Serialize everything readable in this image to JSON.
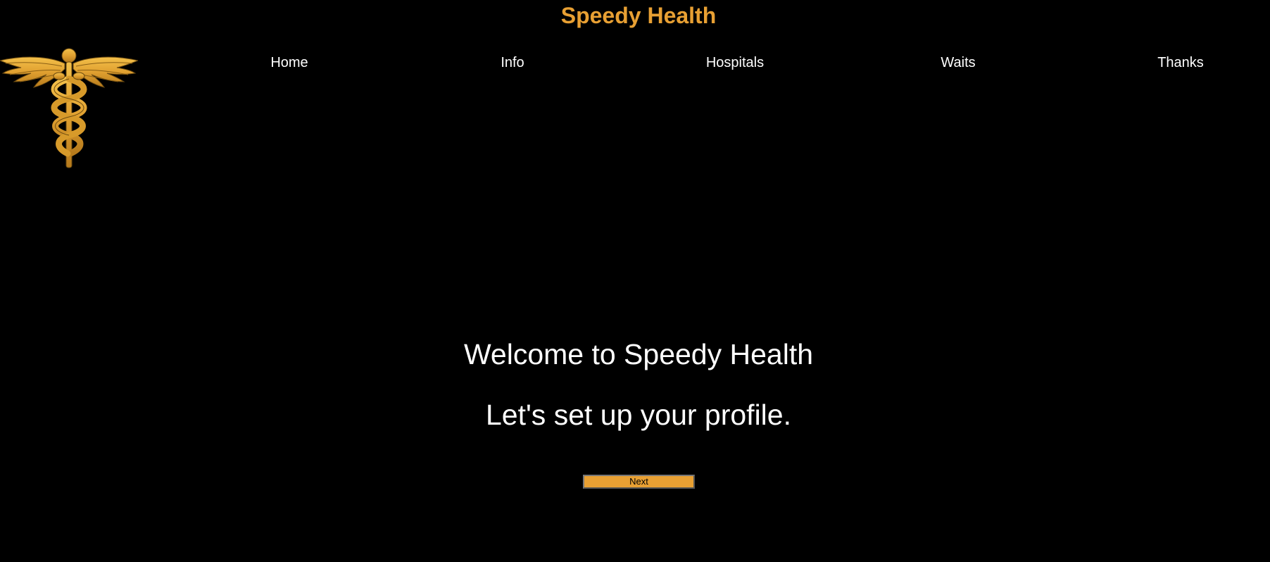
{
  "header": {
    "title": "Speedy Health",
    "title_color": "#e8a033",
    "logo_icon": "caduceus-icon",
    "logo_color": "#e8a033"
  },
  "nav": {
    "items": [
      {
        "label": "Home"
      },
      {
        "label": "Info"
      },
      {
        "label": "Hospitals"
      },
      {
        "label": "Waits"
      },
      {
        "label": "Thanks"
      }
    ]
  },
  "main": {
    "welcome": "Welcome to Speedy Health",
    "subtitle": "Let's set up your profile.",
    "next_label": "Next",
    "button_color": "#e8a033"
  },
  "colors": {
    "background": "#000000",
    "text": "#ffffff",
    "accent": "#e8a033"
  }
}
